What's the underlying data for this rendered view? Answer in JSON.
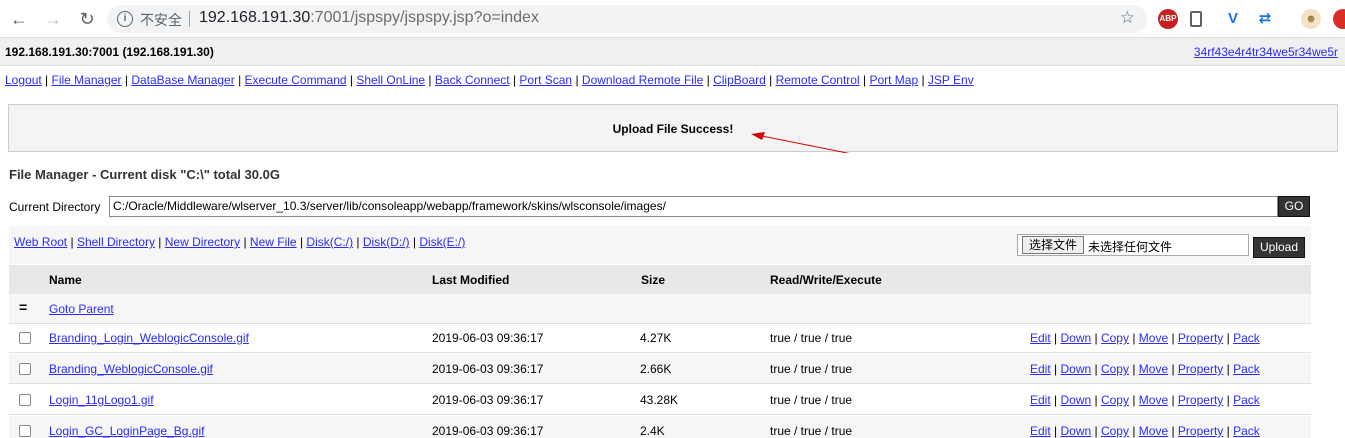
{
  "browser": {
    "insecure_label": "不安全",
    "url_host": "192.168.191.30",
    "url_rest": ":7001/jspspy/jspspy.jsp?o=index",
    "extensions": [
      "ABP",
      "bookmark",
      "V",
      "sync",
      "avatar",
      "close"
    ]
  },
  "hostbar": {
    "host": "192.168.191.30:7001 (192.168.191.30)",
    "hash": "34rf43e4r4tr34we5r34we5r"
  },
  "menu": [
    "Logout",
    "File Manager",
    "DataBase Manager",
    "Execute Command",
    "Shell OnLine",
    "Back Connect",
    "Port Scan",
    "Download Remote File",
    "ClipBoard",
    "Remote Control",
    "Port Map",
    "JSP Env"
  ],
  "message": "Upload File Success!",
  "file_manager": {
    "title": "File Manager - Current disk \"C:\\\" total 30.0G",
    "current_dir_label": "Current Directory",
    "current_dir_value": "C:/Oracle/Middleware/wlserver_10.3/server/lib/consoleapp/webapp/framework/skins/wlsconsole/images/",
    "go_label": "GO",
    "quick_links": [
      "Web Root",
      "Shell Directory",
      "New Directory",
      "New File",
      "Disk(C:/)",
      "Disk(D:/)",
      "Disk(E:/)"
    ],
    "choose_file_label": "选择文件",
    "no_file_label": "未选择任何文件",
    "upload_label": "Upload"
  },
  "table": {
    "headers": [
      "Name",
      "Last Modified",
      "Size",
      "Read/Write/Execute"
    ],
    "parent_symbol": "=",
    "parent_label": "Goto Parent",
    "actions": [
      "Edit",
      "Down",
      "Copy",
      "Move",
      "Property",
      "Pack"
    ],
    "rows": [
      {
        "name": "Branding_Login_WeblogicConsole.gif",
        "modified": "2019-06-03 09:36:17",
        "size": "4.27K",
        "perm": "true / true / true"
      },
      {
        "name": "Branding_WeblogicConsole.gif",
        "modified": "2019-06-03 09:36:17",
        "size": "2.66K",
        "perm": "true / true / true"
      },
      {
        "name": "Login_11gLogo1.gif",
        "modified": "2019-06-03 09:36:17",
        "size": "43.28K",
        "perm": "true / true / true"
      },
      {
        "name": "Login_GC_LoginPage_Bg.gif",
        "modified": "2019-06-03 09:36:17",
        "size": "2.4K",
        "perm": "true / true / true"
      }
    ]
  }
}
